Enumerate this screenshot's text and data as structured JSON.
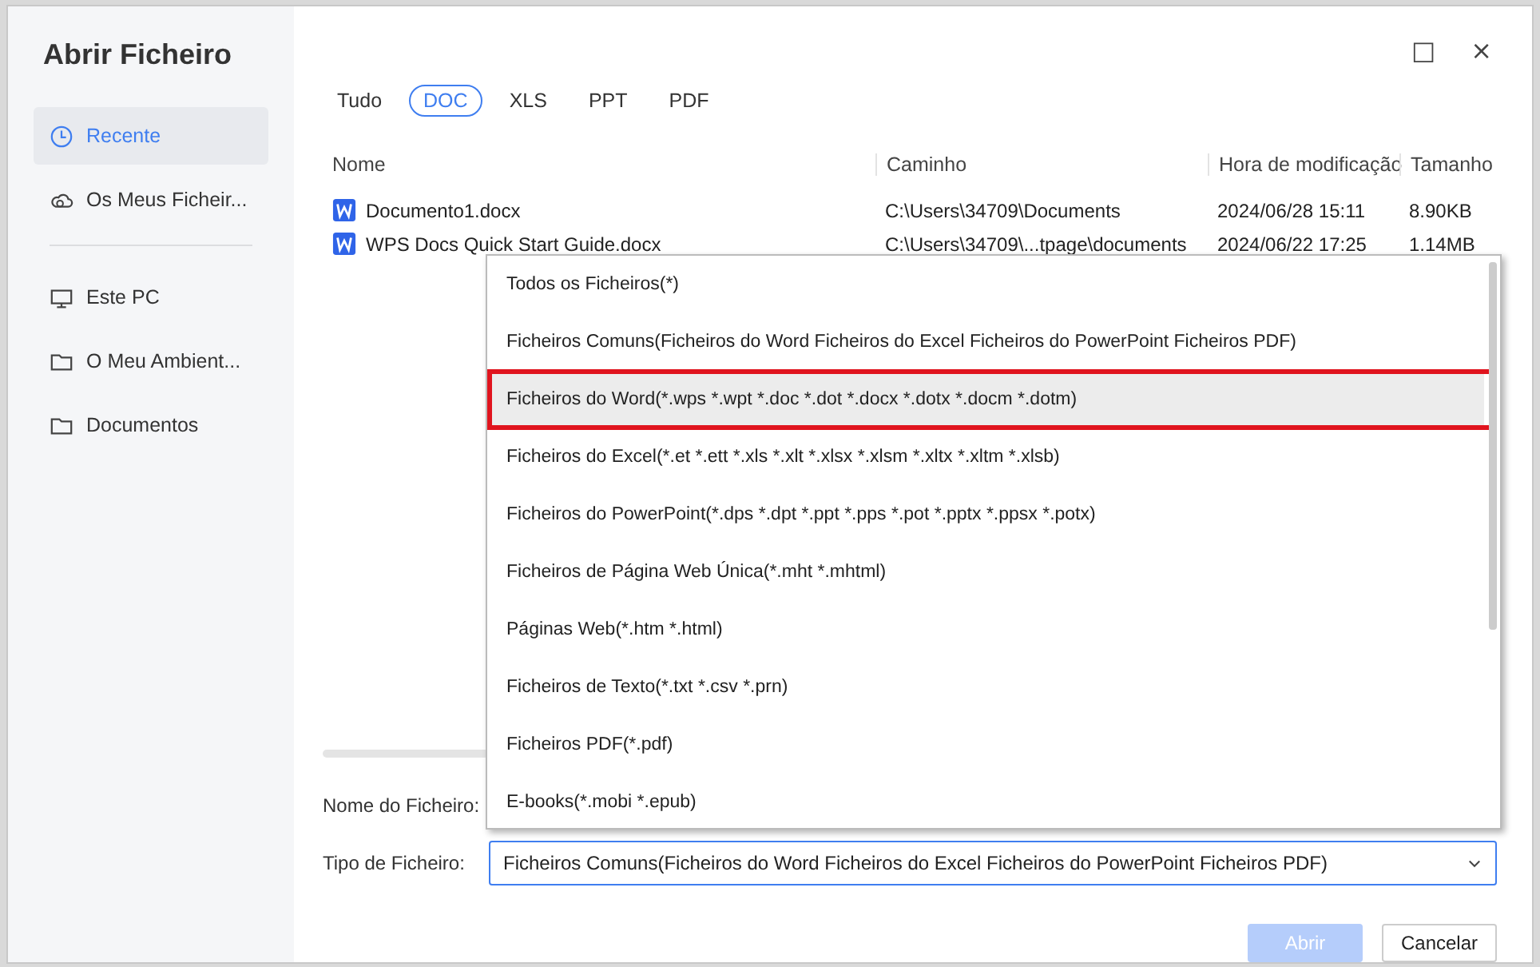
{
  "window": {
    "title": "Abrir Ficheiro"
  },
  "window_controls": [
    "□",
    "×"
  ],
  "sidebar": {
    "groups": [
      [
        {
          "label": "Recente",
          "selected": true
        },
        {
          "label": "Os Meus Ficheir...",
          "selected": false
        }
      ],
      [
        {
          "label": "Este PC",
          "selected": false
        },
        {
          "label": "O Meu Ambient...",
          "selected": false
        },
        {
          "label": "Documentos",
          "selected": false
        }
      ]
    ]
  },
  "tabs": [
    {
      "label": "Tudo",
      "selected": false
    },
    {
      "label": "DOC",
      "selected": true
    },
    {
      "label": "XLS",
      "selected": false
    },
    {
      "label": "PPT",
      "selected": false
    },
    {
      "label": "PDF",
      "selected": false
    }
  ],
  "table": {
    "columns": [
      "Nome",
      "Caminho",
      "Hora de modificação",
      "Tamanho"
    ],
    "rows": [
      [
        "Documento1.docx",
        "C:\\Users\\34709\\Documents",
        "2024/06/28 15:11",
        "8.90KB"
      ],
      [
        "WPS Docs Quick Start Guide.docx",
        "C:\\Users\\34709\\...tpage\\documents",
        "2024/06/22 17:25",
        "1.14MB"
      ]
    ]
  },
  "file_name": {
    "label": "Nome do Ficheiro:"
  },
  "file_type": {
    "label": "Tipo de Ficheiro:",
    "value": "Ficheiros Comuns(Ficheiros do Word Ficheiros do Excel Ficheiros do PowerPoint Ficheiros PDF)",
    "options": [
      {
        "label": "Todos os Ficheiros(*)",
        "highlighted": false,
        "annotated": false
      },
      {
        "label": "Ficheiros Comuns(Ficheiros do Word Ficheiros do Excel Ficheiros do PowerPoint Ficheiros PDF)",
        "highlighted": false,
        "annotated": false
      },
      {
        "label": "Ficheiros do Word(*.wps *.wpt *.doc *.dot *.docx *.dotx *.docm *.dotm)",
        "highlighted": true,
        "annotated": true
      },
      {
        "label": "Ficheiros do Excel(*.et *.ett *.xls *.xlt *.xlsx *.xlsm *.xltx *.xltm *.xlsb)",
        "highlighted": false,
        "annotated": false
      },
      {
        "label": "Ficheiros do PowerPoint(*.dps *.dpt *.ppt *.pps *.pot *.pptx *.ppsx *.potx)",
        "highlighted": false,
        "annotated": false
      },
      {
        "label": "Ficheiros de Página Web Única(*.mht *.mhtml)",
        "highlighted": false,
        "annotated": false
      },
      {
        "label": "Páginas Web(*.htm *.html)",
        "highlighted": false,
        "annotated": false
      },
      {
        "label": "Ficheiros de Texto(*.txt *.csv *.prn)",
        "highlighted": false,
        "annotated": false
      },
      {
        "label": "Ficheiros PDF(*.pdf)",
        "highlighted": false,
        "annotated": false
      },
      {
        "label": "E-books(*.mobi *.epub)",
        "highlighted": false,
        "annotated": false
      }
    ]
  },
  "buttons": [
    {
      "label": "Abrir",
      "kind": "primary",
      "disabled": true
    },
    {
      "label": "Cancelar",
      "kind": "secondary",
      "disabled": false
    }
  ]
}
